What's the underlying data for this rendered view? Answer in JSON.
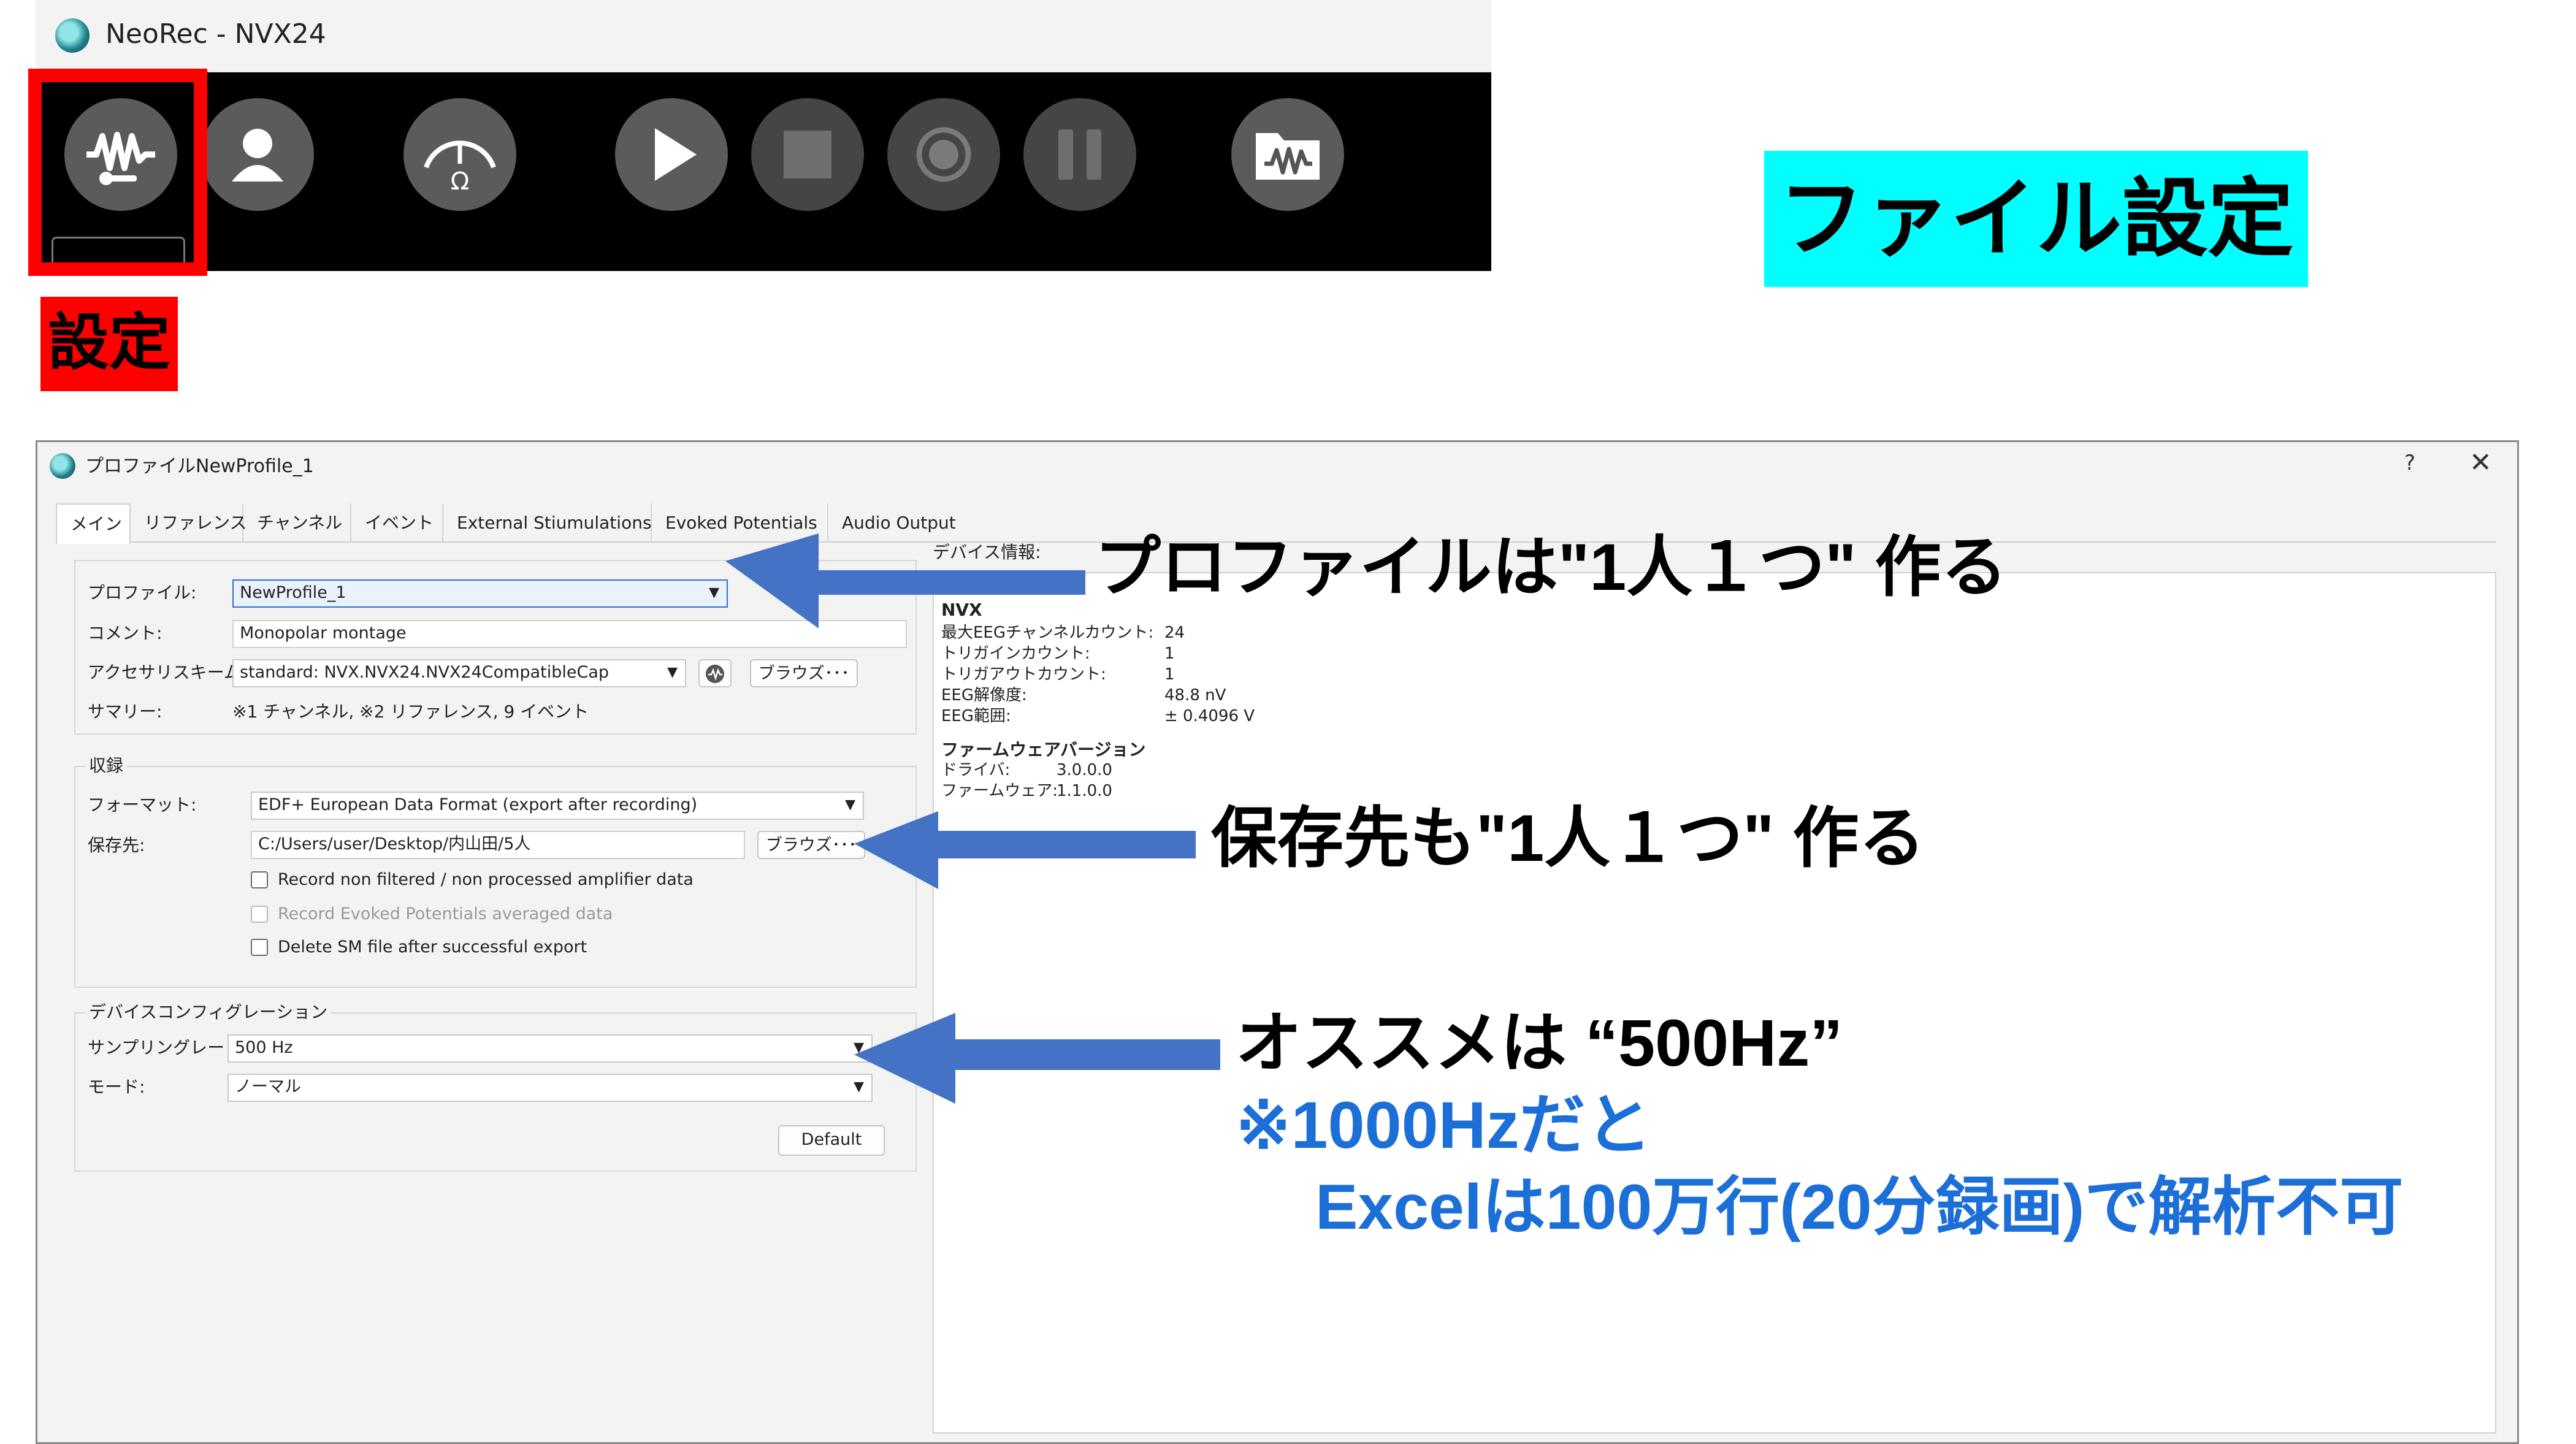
{
  "app": {
    "title": "NeoRec - NVX24",
    "toolbar": [
      {
        "name": "settings-button",
        "icon": "waveform-wrench-icon"
      },
      {
        "name": "participant-button",
        "icon": "user-icon"
      },
      {
        "name": "impedance-button",
        "icon": "impedance-gauge-icon"
      },
      {
        "name": "play-button",
        "icon": "play-icon"
      },
      {
        "name": "stop-button",
        "icon": "stop-icon"
      },
      {
        "name": "record-button",
        "icon": "record-icon"
      },
      {
        "name": "pause-button",
        "icon": "pause-icon"
      },
      {
        "name": "open-recording-button",
        "icon": "folder-waveform-icon"
      }
    ]
  },
  "callouts": {
    "settings_label": "設定",
    "heading": "ファイル設定",
    "profile_note": "プロファイルは\"1人１つ\" 作る",
    "save_note": "保存先も\"1人１つ\" 作る",
    "rate_note": "オススメは “500Hz”",
    "rate_warning_1": "※1000Hzだと",
    "rate_warning_2": "Excelは100万行(20分録画)で解析不可"
  },
  "colors": {
    "highlight_red": "#ff0000",
    "heading_bg": "#00ffff",
    "arrow_blue": "#4472c4",
    "warning_blue": "#1d6fd8"
  },
  "dialog": {
    "title": "プロファイルNewProfile_1",
    "help": "?",
    "close": "✕",
    "tabs": [
      "メイン",
      "リファレンス",
      "チャンネル",
      "イベント",
      "External Stiumulations",
      "Evoked Potentials",
      "Audio Output"
    ],
    "active_tab": "メイン",
    "profile": {
      "profile_label": "プロファイル:",
      "profile_value": "NewProfile_1",
      "comment_label": "コメント:",
      "comment_value": "Monopolar montage",
      "accessory_label": "アクセサリスキーム:",
      "accessory_value": "standard: NVX.NVX24.NVX24CompatibleCap",
      "browse_label": "ブラウズ･･･",
      "summary_label": "サマリー:",
      "summary_value": "※1 チャンネル, ※2 リファレンス, 9 イベント"
    },
    "recording": {
      "group_title": "収録",
      "format_label": "フォーマット:",
      "format_value": "EDF+ European Data Format (export after recording)",
      "save_label": "保存先:",
      "save_value": "C:/Users/user/Desktop/内山田/5人",
      "browse_label": "ブラウズ･･･",
      "checkboxes": [
        {
          "label": "Record non filtered / non processed amplifier data",
          "checked": false,
          "enabled": true
        },
        {
          "label": "Record Evoked Potentials averaged data",
          "checked": false,
          "enabled": false
        },
        {
          "label": "Delete SM file after successful export",
          "checked": false,
          "enabled": true
        }
      ]
    },
    "device_config": {
      "group_title": "デバイスコンフィグレーション",
      "rate_label": "サンプリングレート:",
      "rate_value": "500 Hz",
      "mode_label": "モード:",
      "mode_value": "ノーマル",
      "default_button": "Default"
    },
    "device_info": {
      "title": "デバイス情報:",
      "device_name": "NVX",
      "rows": [
        {
          "k": "最大EEGチャンネルカウント:",
          "v": "24"
        },
        {
          "k": "トリガインカウント:",
          "v": "1"
        },
        {
          "k": "トリガアウトカウント:",
          "v": "1"
        },
        {
          "k": "EEG解像度:",
          "v": "48.8 nV"
        },
        {
          "k": "EEG範囲:",
          "v": "± 0.4096 V"
        }
      ],
      "firmware_title": "ファームウェアバージョン",
      "firmware_rows": [
        {
          "k": "ドライバ:",
          "v": "3.0.0.0"
        },
        {
          "k": "ファームウェア:",
          "v": "1.1.0.0"
        }
      ]
    }
  }
}
